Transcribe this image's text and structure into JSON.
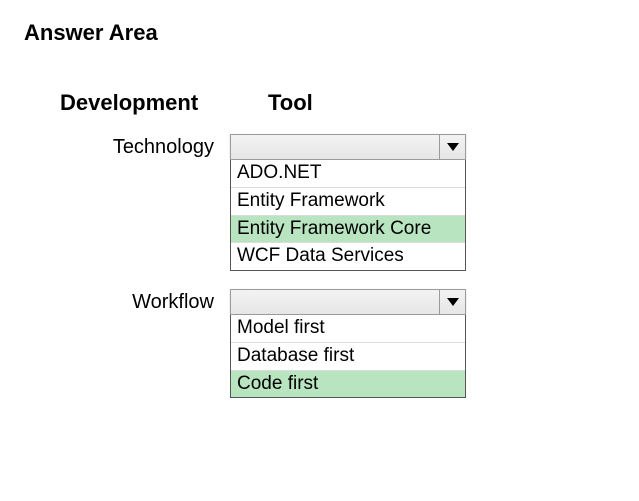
{
  "title": "Answer Area",
  "headers": {
    "development": "Development",
    "tool": "Tool"
  },
  "rows": {
    "technology": {
      "label": "Technology",
      "options": {
        "o0": "ADO.NET",
        "o1": "Entity Framework",
        "o2": "Entity Framework Core",
        "o3": "WCF Data Services"
      },
      "selected_index": 2
    },
    "workflow": {
      "label": "Workflow",
      "options": {
        "o0": "Model first",
        "o1": "Database first",
        "o2": "Code first"
      },
      "selected_index": 2
    }
  },
  "colors": {
    "highlight": "#b8e4c0"
  }
}
